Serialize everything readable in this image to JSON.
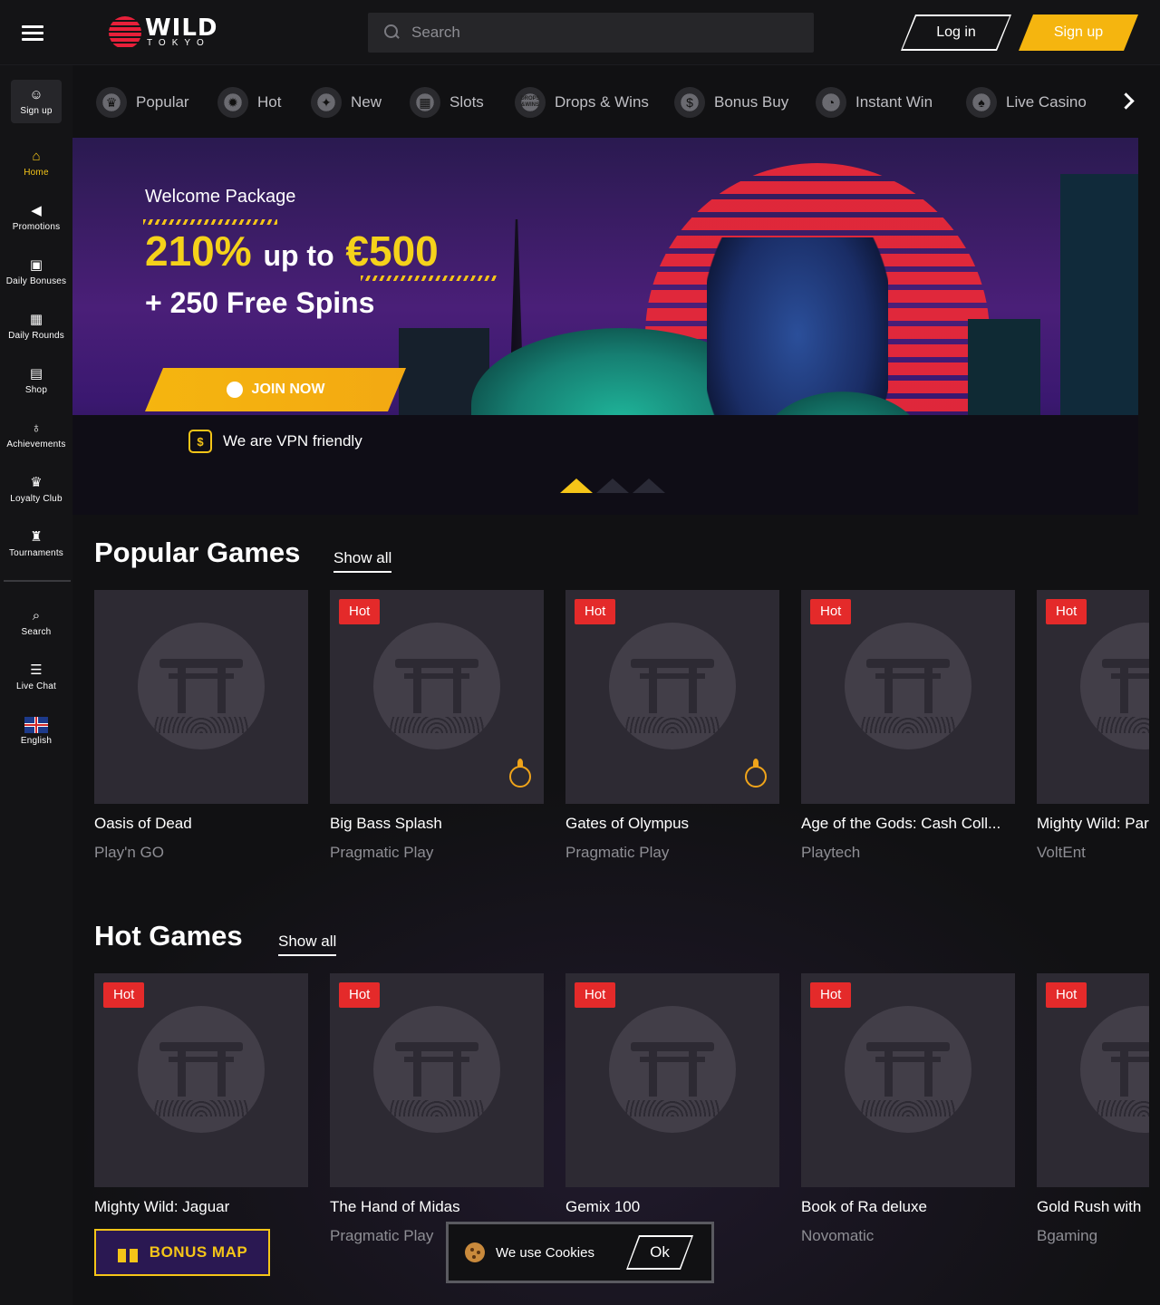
{
  "header": {
    "logo_word": "WILD",
    "logo_sub": "TOKYO",
    "search_placeholder": "Search",
    "login_label": "Log in",
    "signup_label": "Sign up"
  },
  "sidebar": {
    "signup_label": "Sign up",
    "items": [
      {
        "label": "Home",
        "icon": "home-icon"
      },
      {
        "label": "Promotions",
        "icon": "megaphone-icon"
      },
      {
        "label": "Daily Bonuses",
        "icon": "gift-icon"
      },
      {
        "label": "Daily Rounds",
        "icon": "calendar-icon"
      },
      {
        "label": "Shop",
        "icon": "shop-icon"
      },
      {
        "label": "Achievements",
        "icon": "medal-icon"
      },
      {
        "label": "Loyalty Club",
        "icon": "crown-icon"
      },
      {
        "label": "Tournaments",
        "icon": "trophy-icon"
      },
      {
        "label": "Search",
        "icon": "search-icon"
      },
      {
        "label": "Live Chat",
        "icon": "chat-icon"
      },
      {
        "label": "English",
        "icon": "uk-flag-icon"
      }
    ]
  },
  "categories": [
    {
      "label": "Popular"
    },
    {
      "label": "Hot"
    },
    {
      "label": "New"
    },
    {
      "label": "Slots"
    },
    {
      "label": "Drops & Wins",
      "icon_text": "DROPS &WINS"
    },
    {
      "label": "Bonus Buy"
    },
    {
      "label": "Instant Win"
    },
    {
      "label": "Live Casino"
    }
  ],
  "hero": {
    "title": "Welcome Package",
    "offer_pct": "210%",
    "offer_mid": "up to",
    "offer_amount": "€500",
    "spins": "+ 250 Free Spins",
    "join_label": "JOIN NOW",
    "vpn_text": "We are VPN friendly",
    "accent": "#f5c518"
  },
  "popular": {
    "title": "Popular Games",
    "show_all": "Show all",
    "games": [
      {
        "name": "Oasis of Dead",
        "provider": "Play'n GO",
        "badge": ""
      },
      {
        "name": "Big Bass Splash",
        "provider": "Pragmatic Play",
        "badge": "Hot"
      },
      {
        "name": "Gates of Olympus",
        "provider": "Pragmatic Play",
        "badge": "Hot"
      },
      {
        "name": "Age of the Gods: Cash Coll...",
        "provider": "Playtech",
        "badge": "Hot"
      },
      {
        "name": "Mighty Wild: Par",
        "provider": "VoltEnt",
        "badge": "Hot"
      }
    ]
  },
  "hot": {
    "title": "Hot Games",
    "show_all": "Show all",
    "games": [
      {
        "name": "Mighty Wild: Jaguar",
        "provider": "",
        "badge": "Hot"
      },
      {
        "name": "The Hand of Midas",
        "provider": "Pragmatic Play",
        "badge": "Hot"
      },
      {
        "name": "Gemix 100",
        "provider": "",
        "badge": "Hot"
      },
      {
        "name": "Book of Ra deluxe",
        "provider": "Novomatic",
        "badge": "Hot"
      },
      {
        "name": "Gold Rush with",
        "provider": "Bgaming",
        "badge": "Hot"
      }
    ]
  },
  "bonus_map_label": "BONUS MAP",
  "cookies": {
    "text": "We use Cookies",
    "ok_label": "Ok"
  }
}
